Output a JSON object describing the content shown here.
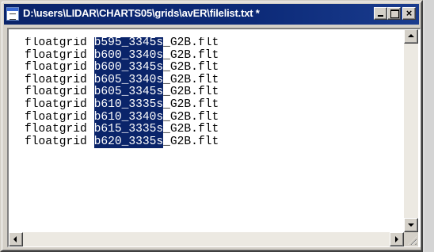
{
  "window": {
    "title": "D:\\users\\LIDAR\\CHARTS05\\grids\\avER\\filelist.txt *",
    "icon": "notepad-document-icon",
    "colors": {
      "titlebar": "#0a246a",
      "selection": "#0a246a",
      "chrome": "#d4d0c8"
    }
  },
  "controls": {
    "minimize": "minimize-icon",
    "maximize": "maximize-icon",
    "close": "close-icon",
    "close_glyph": "×"
  },
  "editor": {
    "lines": [
      {
        "prefix": "floatgrid ",
        "selected": "b595_3345s",
        "suffix": "_G2B.flt"
      },
      {
        "prefix": "floatgrid ",
        "selected": "b600_3340s",
        "suffix": "_G2B.flt"
      },
      {
        "prefix": "floatgrid ",
        "selected": "b600_3345s",
        "suffix": "_G2B.flt"
      },
      {
        "prefix": "floatgrid ",
        "selected": "b605_3340s",
        "suffix": "_G2B.flt"
      },
      {
        "prefix": "floatgrid ",
        "selected": "b605_3345s",
        "suffix": "_G2B.flt"
      },
      {
        "prefix": "floatgrid ",
        "selected": "b610_3335s",
        "suffix": "_G2B.flt"
      },
      {
        "prefix": "floatgrid ",
        "selected": "b610_3340s",
        "suffix": "_G2B.flt"
      },
      {
        "prefix": "floatgrid ",
        "selected": "b615_3335s",
        "suffix": "_G2B.flt"
      },
      {
        "prefix": "floatgrid ",
        "selected": "b620_3335s",
        "suffix": "_G2B.flt"
      }
    ]
  },
  "scrollbars": {
    "up": "arrow-up-icon",
    "down": "arrow-down-icon",
    "left": "arrow-left-icon",
    "right": "arrow-right-icon"
  }
}
